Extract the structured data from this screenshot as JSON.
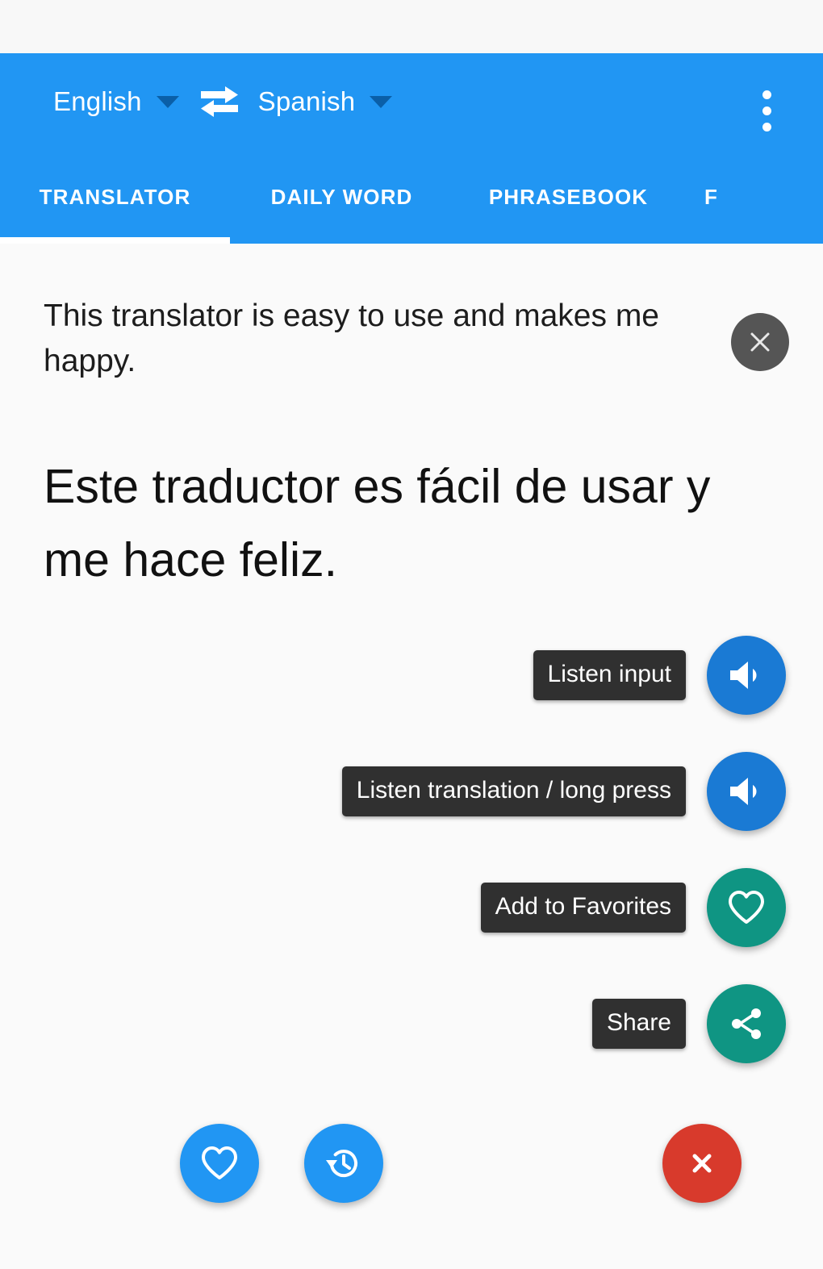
{
  "appbar": {
    "source_language": "English",
    "target_language": "Spanish",
    "swap_icon": "swap-horizontal-icon",
    "overflow_icon": "overflow-menu-icon",
    "background_color": "#2196f3"
  },
  "tabs": [
    {
      "label": "TRANSLATOR",
      "active": true
    },
    {
      "label": "DAILY WORD",
      "active": false
    },
    {
      "label": "PHRASEBOOK",
      "active": false
    },
    {
      "label": "F",
      "active": false
    }
  ],
  "translator": {
    "source_text": "This translator is easy to use and makes me happy.",
    "target_text": "Este traductor es fácil de usar y me hace feliz.",
    "clear_icon": "close-icon"
  },
  "speed_dial": [
    {
      "label": "Listen input",
      "icon": "volume-up-icon",
      "color": "#1a7ad4"
    },
    {
      "label": "Listen translation / long press",
      "icon": "volume-up-icon",
      "color": "#1a7ad4"
    },
    {
      "label": "Add to Favorites",
      "icon": "heart-outline-icon",
      "color": "#0f9583"
    },
    {
      "label": "Share",
      "icon": "share-icon",
      "color": "#0f9583"
    }
  ],
  "bottom_bar": {
    "favorites_icon": "heart-outline-icon",
    "history_icon": "history-icon",
    "close_icon": "close-icon",
    "favorites_color": "#2196f3",
    "history_color": "#2196f3",
    "close_color": "#d83a2c"
  }
}
